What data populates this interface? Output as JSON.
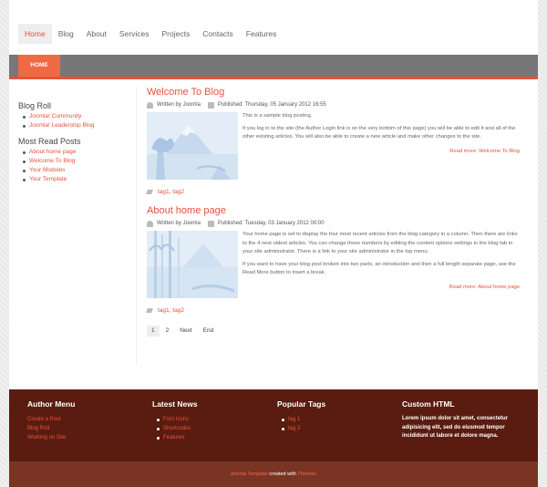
{
  "nav": {
    "items": [
      "Home",
      "Blog",
      "About",
      "Services",
      "Projects",
      "Contacts",
      "Features"
    ],
    "active_index": 0
  },
  "breadcrumb": {
    "home": "HOME"
  },
  "sidebar": {
    "blog_roll": {
      "title": "Blog Roll",
      "items": [
        "Joomla! Community",
        "Joomla! Leadership Blog"
      ]
    },
    "most_read": {
      "title": "Most Read Posts",
      "items": [
        "About home page",
        "Welcome To Blog",
        "Your Modules",
        "Your Template"
      ]
    }
  },
  "articles": [
    {
      "title": "Welcome To Blog",
      "author": "Written by Joomla",
      "published": "Published: Thursday, 05 January 2012 16:55",
      "paragraphs": [
        "This is a sample blog posting.",
        "If you log in to the site (the Author Login link is on the very bottom of this page) you will be able to edit it and all of the other existing articles. You will also be able to create a new article and make other changes to the site."
      ],
      "readmore": "Read more: Welcome To Blog",
      "tags": [
        "tag1",
        "tag2"
      ]
    },
    {
      "title": "About home page",
      "author": "Written by Joomla",
      "published": "Published: Tuesday, 03 January 2012 00:00",
      "paragraphs": [
        "Your home page is set to display the four most recent articles from the blog category in a column. Then there are links to the 4 nest oldest articles. You can change those numbers by editing the content options settings in the blog tab in your site administrator. There is a link to your site administrator in the top menu.",
        "If you want to have your blog post broken into two parts, an introduction and then a full length separate page, use the Read More button to insert a break."
      ],
      "readmore": "Read more: About home page",
      "tags": [
        "tag1",
        "tag2"
      ]
    }
  ],
  "pager": [
    "1",
    "2",
    "Next",
    "End"
  ],
  "footer": {
    "author_menu": {
      "title": "Author Menu",
      "items": [
        "Create a Post",
        "Blog Roll",
        "Working on Site"
      ]
    },
    "latest_news": {
      "title": "Latest News",
      "items": [
        "Font Icons",
        "Shortcodes",
        "Features"
      ]
    },
    "popular_tags": {
      "title": "Popular Tags",
      "items": [
        "tag 1",
        "tag 2"
      ]
    },
    "custom_html": {
      "title": "Custom HTML",
      "text": "Lorem ipsum dolor sit amet, consectetur adipisicing elit, sed do eiusmod tempor incididunt ut labore et dolore magna."
    }
  },
  "copyright": {
    "link1": "Joomla Template",
    "middle": " created with ",
    "link2": "Themler",
    "end": "."
  },
  "colors": {
    "accent": "#e8523a",
    "footer_bg": "#5a1c10",
    "copyright_bg": "#7a3424",
    "bar": "#777777"
  }
}
